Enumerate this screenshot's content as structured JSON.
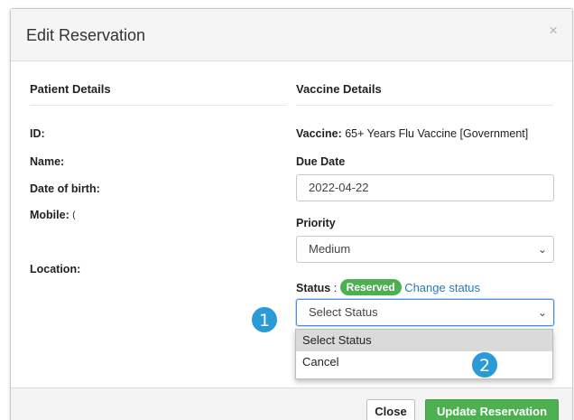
{
  "modal": {
    "title": "Edit Reservation",
    "close_glyph": "×"
  },
  "patient": {
    "heading": "Patient Details",
    "id_label": "ID:",
    "name_label": "Name:",
    "dob_label": "Date of birth:",
    "mobile_label": "Mobile:",
    "mobile_value": "(",
    "location_label": "Location:"
  },
  "vaccine": {
    "heading": "Vaccine Details",
    "vaccine_label": "Vaccine:",
    "vaccine_value": "65+ Years Flu Vaccine [Government]",
    "due_date_label": "Due Date",
    "due_date_value": "2022-04-22",
    "priority_label": "Priority",
    "priority_value": "Medium",
    "status_label": "Status",
    "status_separator": ":",
    "status_badge": "Reserved",
    "change_status_link": "Change status",
    "status_select_value": "Select Status",
    "status_options": [
      "Select Status",
      "Cancel"
    ]
  },
  "footer": {
    "close_label": "Close",
    "update_label": "Update Reservation"
  },
  "markers": [
    "1",
    "2"
  ],
  "colors": {
    "accent_green": "#4caf50",
    "link_blue": "#2a7ab8",
    "marker_blue": "#2b9ad6"
  }
}
